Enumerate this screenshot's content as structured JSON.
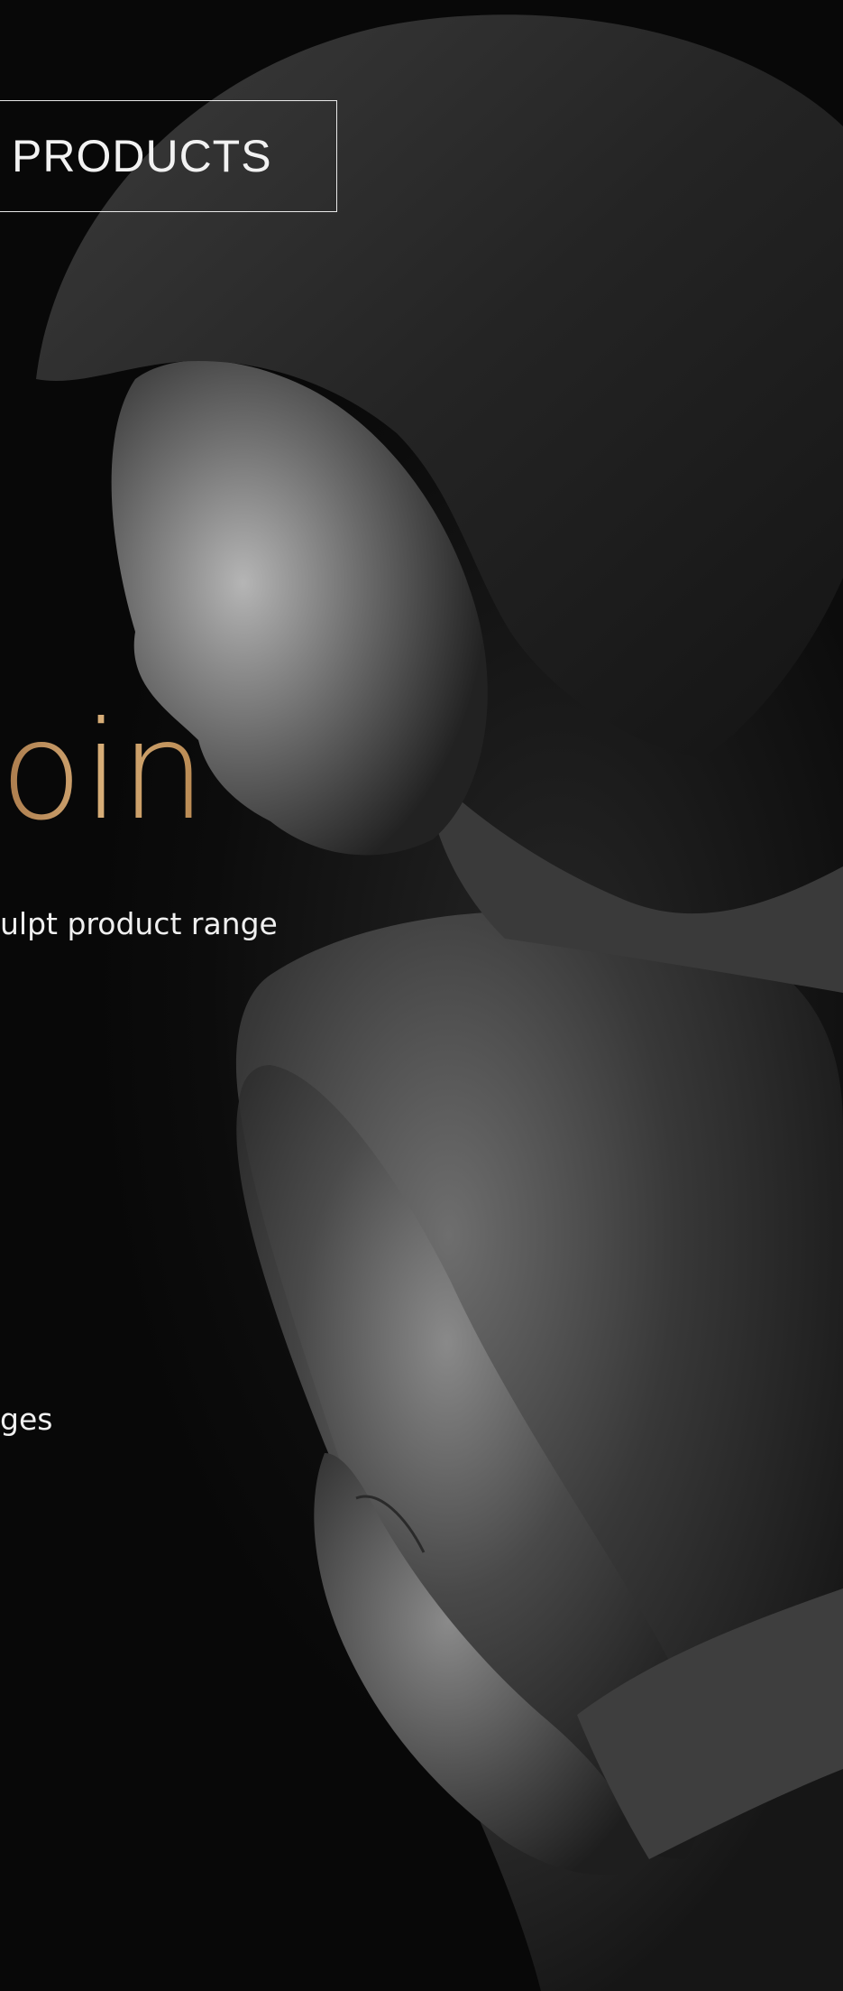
{
  "header": {
    "products_label": "PRODUCTS"
  },
  "hero": {
    "title": "oin",
    "subtitle": "ulpt product range",
    "caption": "ges",
    "photo_alt": "black-and-white portrait of a woman",
    "accent_color": "#c79b64"
  }
}
